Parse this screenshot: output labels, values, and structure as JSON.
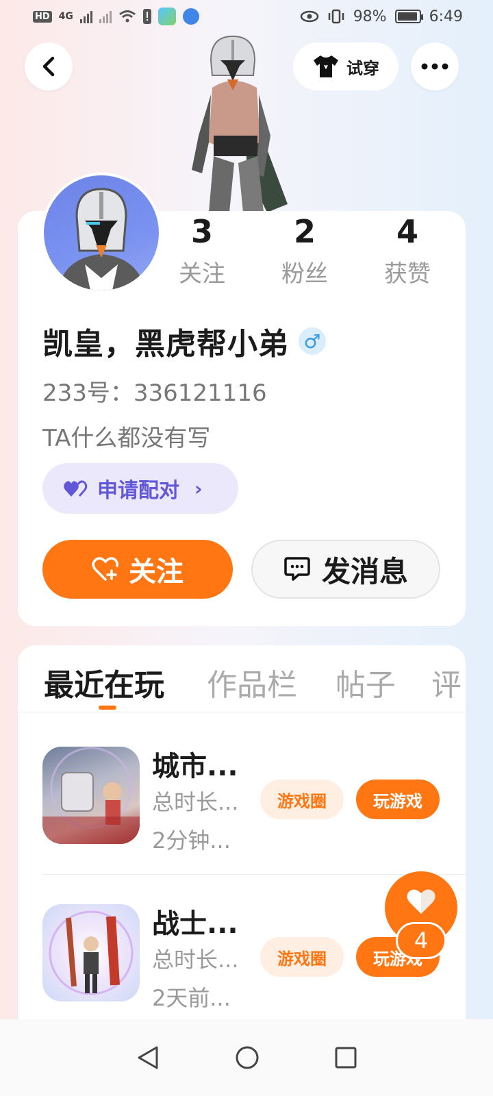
{
  "status_bar": {
    "hd_label": "HD",
    "network_label": "4G",
    "battery_text": "98%",
    "time": "6:49"
  },
  "header": {
    "tryon_label": "试穿"
  },
  "profile": {
    "stats": [
      {
        "value": "3",
        "label": "关注"
      },
      {
        "value": "2",
        "label": "粉丝"
      },
      {
        "value": "4",
        "label": "获赞"
      }
    ],
    "nickname": "凯皇，黑虎帮小弟",
    "gender_symbol": "♂",
    "uid": "233号：336121116",
    "bio": "TA什么都没有写",
    "pair_label": "申请配对",
    "follow_label": "关注",
    "message_label": "发消息"
  },
  "tabs": [
    "最近在玩",
    "作品栏",
    "帖子",
    "评"
  ],
  "games": [
    {
      "title": "城市...",
      "meta1": "总时长...",
      "meta2": "2分钟...",
      "circle_label": "游戏圈",
      "play_label": "玩游戏"
    },
    {
      "title": "战士...",
      "meta1": "总时长...",
      "meta2": "2天前...",
      "circle_label": "游戏圈",
      "play_label": "玩游戏"
    }
  ],
  "floating_like": {
    "count": "4"
  },
  "colors": {
    "accent": "#ff7613",
    "pair": "#6257d8"
  },
  "icons": [
    "back-arrow-icon",
    "tshirt-icon",
    "more-dots-icon",
    "heart-icon",
    "heart-plus-icon",
    "chat-bubble-icon",
    "nav-back-icon",
    "nav-home-icon",
    "nav-recent-icon"
  ]
}
